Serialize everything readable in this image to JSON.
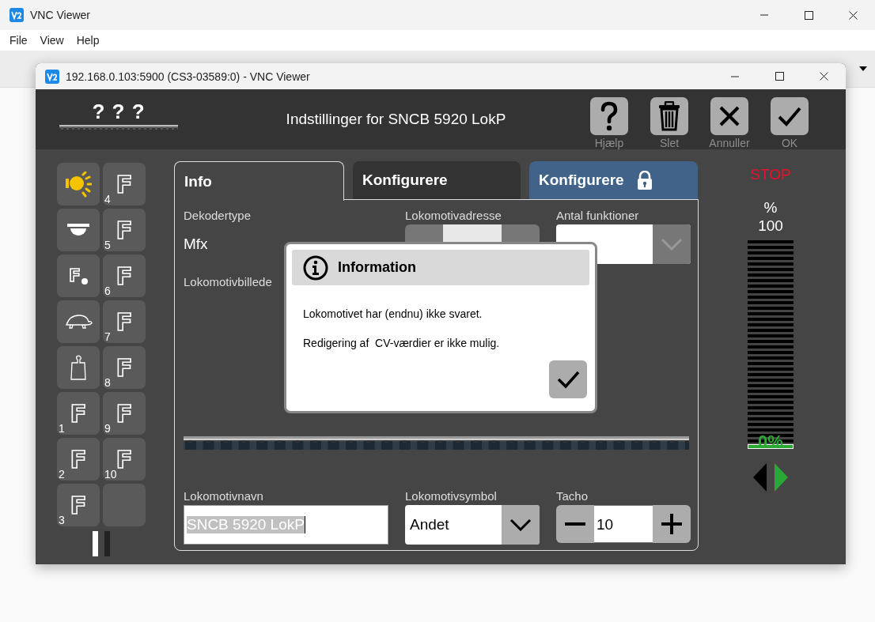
{
  "outer_window": {
    "title": "VNC Viewer",
    "menu": [
      "File",
      "View",
      "Help"
    ]
  },
  "vnc_window": {
    "title": "192.168.0.103:5900 (CS3-03589:0) - VNC Viewer"
  },
  "header": {
    "logo_text": "? ? ?",
    "title": "Indstillinger for SNCB 5920 LokP",
    "buttons": [
      {
        "kind": "help",
        "label": "Hjælp"
      },
      {
        "kind": "delete",
        "label": "Slet"
      },
      {
        "kind": "cancel",
        "label": "Annuller"
      },
      {
        "kind": "ok",
        "label": "OK"
      }
    ]
  },
  "function_keys": [
    {
      "kind": "light",
      "on": true
    },
    {
      "kind": "f",
      "glyph": "F",
      "number": "4",
      "on": false
    },
    {
      "kind": "dome",
      "on": false
    },
    {
      "kind": "f",
      "glyph": "F",
      "number": "5",
      "on": false
    },
    {
      "kind": "f-dot",
      "glyph": "F",
      "on": false
    },
    {
      "kind": "f",
      "glyph": "F",
      "number": "6",
      "on": false
    },
    {
      "kind": "turtle",
      "on": false
    },
    {
      "kind": "f",
      "glyph": "F",
      "number": "7",
      "on": false
    },
    {
      "kind": "weight",
      "on": false
    },
    {
      "kind": "f",
      "glyph": "F",
      "number": "8",
      "on": false
    },
    {
      "kind": "f",
      "glyph": "F",
      "number": "1",
      "on": false
    },
    {
      "kind": "f",
      "glyph": "F",
      "number": "9",
      "on": false
    },
    {
      "kind": "f",
      "glyph": "F",
      "number": "2",
      "on": false
    },
    {
      "kind": "f",
      "glyph": "F",
      "number": "10",
      "on": false
    },
    {
      "kind": "f",
      "glyph": "F",
      "number": "3",
      "on": false
    },
    {
      "kind": "empty",
      "on": false
    }
  ],
  "tabs": [
    {
      "label": "Info",
      "selected": true,
      "locked": false
    },
    {
      "label": "Konfigurere",
      "selected": false,
      "locked": false
    },
    {
      "label": "Konfigurere",
      "selected": false,
      "locked": true
    }
  ],
  "fields": {
    "decoder_type": {
      "label": "Dekodertype",
      "value": "Mfx"
    },
    "address": {
      "label": "Lokomotivadresse"
    },
    "function_count": {
      "label": "Antal funktioner"
    },
    "picture": {
      "label": "Lokomotivbillede"
    },
    "name": {
      "label": "Lokomotivnavn",
      "value": "SNCB 5920 LokP"
    },
    "symbol": {
      "label": "Lokomotivsymbol",
      "value": "Andet"
    },
    "tacho": {
      "label": "Tacho",
      "value": "10"
    }
  },
  "dialog": {
    "title": "Information",
    "lines": [
      "Lokomotivet har (endnu) ikke svaret.",
      "Redigering af  CV-værdier er ikke mulig."
    ]
  },
  "speed": {
    "stop": "STOP",
    "unit": "%",
    "max": "100",
    "level": 0,
    "reading": "0%",
    "forward": true
  }
}
